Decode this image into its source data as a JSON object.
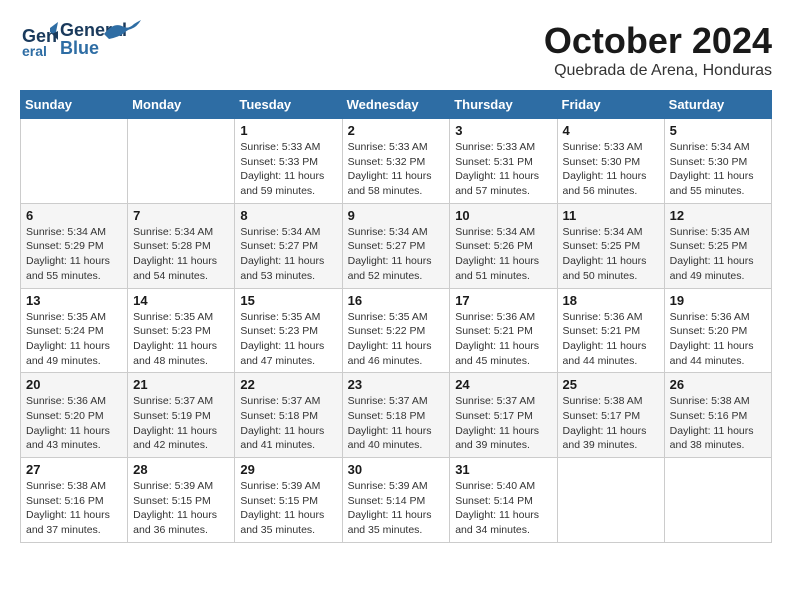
{
  "header": {
    "logo_general": "General",
    "logo_blue": "Blue",
    "month": "October 2024",
    "location": "Quebrada de Arena, Honduras"
  },
  "weekdays": [
    "Sunday",
    "Monday",
    "Tuesday",
    "Wednesday",
    "Thursday",
    "Friday",
    "Saturday"
  ],
  "weeks": [
    [
      {
        "day": "",
        "sunrise": "",
        "sunset": "",
        "daylight": ""
      },
      {
        "day": "",
        "sunrise": "",
        "sunset": "",
        "daylight": ""
      },
      {
        "day": "1",
        "sunrise": "Sunrise: 5:33 AM",
        "sunset": "Sunset: 5:33 PM",
        "daylight": "Daylight: 11 hours and 59 minutes."
      },
      {
        "day": "2",
        "sunrise": "Sunrise: 5:33 AM",
        "sunset": "Sunset: 5:32 PM",
        "daylight": "Daylight: 11 hours and 58 minutes."
      },
      {
        "day": "3",
        "sunrise": "Sunrise: 5:33 AM",
        "sunset": "Sunset: 5:31 PM",
        "daylight": "Daylight: 11 hours and 57 minutes."
      },
      {
        "day": "4",
        "sunrise": "Sunrise: 5:33 AM",
        "sunset": "Sunset: 5:30 PM",
        "daylight": "Daylight: 11 hours and 56 minutes."
      },
      {
        "day": "5",
        "sunrise": "Sunrise: 5:34 AM",
        "sunset": "Sunset: 5:30 PM",
        "daylight": "Daylight: 11 hours and 55 minutes."
      }
    ],
    [
      {
        "day": "6",
        "sunrise": "Sunrise: 5:34 AM",
        "sunset": "Sunset: 5:29 PM",
        "daylight": "Daylight: 11 hours and 55 minutes."
      },
      {
        "day": "7",
        "sunrise": "Sunrise: 5:34 AM",
        "sunset": "Sunset: 5:28 PM",
        "daylight": "Daylight: 11 hours and 54 minutes."
      },
      {
        "day": "8",
        "sunrise": "Sunrise: 5:34 AM",
        "sunset": "Sunset: 5:27 PM",
        "daylight": "Daylight: 11 hours and 53 minutes."
      },
      {
        "day": "9",
        "sunrise": "Sunrise: 5:34 AM",
        "sunset": "Sunset: 5:27 PM",
        "daylight": "Daylight: 11 hours and 52 minutes."
      },
      {
        "day": "10",
        "sunrise": "Sunrise: 5:34 AM",
        "sunset": "Sunset: 5:26 PM",
        "daylight": "Daylight: 11 hours and 51 minutes."
      },
      {
        "day": "11",
        "sunrise": "Sunrise: 5:34 AM",
        "sunset": "Sunset: 5:25 PM",
        "daylight": "Daylight: 11 hours and 50 minutes."
      },
      {
        "day": "12",
        "sunrise": "Sunrise: 5:35 AM",
        "sunset": "Sunset: 5:25 PM",
        "daylight": "Daylight: 11 hours and 49 minutes."
      }
    ],
    [
      {
        "day": "13",
        "sunrise": "Sunrise: 5:35 AM",
        "sunset": "Sunset: 5:24 PM",
        "daylight": "Daylight: 11 hours and 49 minutes."
      },
      {
        "day": "14",
        "sunrise": "Sunrise: 5:35 AM",
        "sunset": "Sunset: 5:23 PM",
        "daylight": "Daylight: 11 hours and 48 minutes."
      },
      {
        "day": "15",
        "sunrise": "Sunrise: 5:35 AM",
        "sunset": "Sunset: 5:23 PM",
        "daylight": "Daylight: 11 hours and 47 minutes."
      },
      {
        "day": "16",
        "sunrise": "Sunrise: 5:35 AM",
        "sunset": "Sunset: 5:22 PM",
        "daylight": "Daylight: 11 hours and 46 minutes."
      },
      {
        "day": "17",
        "sunrise": "Sunrise: 5:36 AM",
        "sunset": "Sunset: 5:21 PM",
        "daylight": "Daylight: 11 hours and 45 minutes."
      },
      {
        "day": "18",
        "sunrise": "Sunrise: 5:36 AM",
        "sunset": "Sunset: 5:21 PM",
        "daylight": "Daylight: 11 hours and 44 minutes."
      },
      {
        "day": "19",
        "sunrise": "Sunrise: 5:36 AM",
        "sunset": "Sunset: 5:20 PM",
        "daylight": "Daylight: 11 hours and 44 minutes."
      }
    ],
    [
      {
        "day": "20",
        "sunrise": "Sunrise: 5:36 AM",
        "sunset": "Sunset: 5:20 PM",
        "daylight": "Daylight: 11 hours and 43 minutes."
      },
      {
        "day": "21",
        "sunrise": "Sunrise: 5:37 AM",
        "sunset": "Sunset: 5:19 PM",
        "daylight": "Daylight: 11 hours and 42 minutes."
      },
      {
        "day": "22",
        "sunrise": "Sunrise: 5:37 AM",
        "sunset": "Sunset: 5:18 PM",
        "daylight": "Daylight: 11 hours and 41 minutes."
      },
      {
        "day": "23",
        "sunrise": "Sunrise: 5:37 AM",
        "sunset": "Sunset: 5:18 PM",
        "daylight": "Daylight: 11 hours and 40 minutes."
      },
      {
        "day": "24",
        "sunrise": "Sunrise: 5:37 AM",
        "sunset": "Sunset: 5:17 PM",
        "daylight": "Daylight: 11 hours and 39 minutes."
      },
      {
        "day": "25",
        "sunrise": "Sunrise: 5:38 AM",
        "sunset": "Sunset: 5:17 PM",
        "daylight": "Daylight: 11 hours and 39 minutes."
      },
      {
        "day": "26",
        "sunrise": "Sunrise: 5:38 AM",
        "sunset": "Sunset: 5:16 PM",
        "daylight": "Daylight: 11 hours and 38 minutes."
      }
    ],
    [
      {
        "day": "27",
        "sunrise": "Sunrise: 5:38 AM",
        "sunset": "Sunset: 5:16 PM",
        "daylight": "Daylight: 11 hours and 37 minutes."
      },
      {
        "day": "28",
        "sunrise": "Sunrise: 5:39 AM",
        "sunset": "Sunset: 5:15 PM",
        "daylight": "Daylight: 11 hours and 36 minutes."
      },
      {
        "day": "29",
        "sunrise": "Sunrise: 5:39 AM",
        "sunset": "Sunset: 5:15 PM",
        "daylight": "Daylight: 11 hours and 35 minutes."
      },
      {
        "day": "30",
        "sunrise": "Sunrise: 5:39 AM",
        "sunset": "Sunset: 5:14 PM",
        "daylight": "Daylight: 11 hours and 35 minutes."
      },
      {
        "day": "31",
        "sunrise": "Sunrise: 5:40 AM",
        "sunset": "Sunset: 5:14 PM",
        "daylight": "Daylight: 11 hours and 34 minutes."
      },
      {
        "day": "",
        "sunrise": "",
        "sunset": "",
        "daylight": ""
      },
      {
        "day": "",
        "sunrise": "",
        "sunset": "",
        "daylight": ""
      }
    ]
  ]
}
